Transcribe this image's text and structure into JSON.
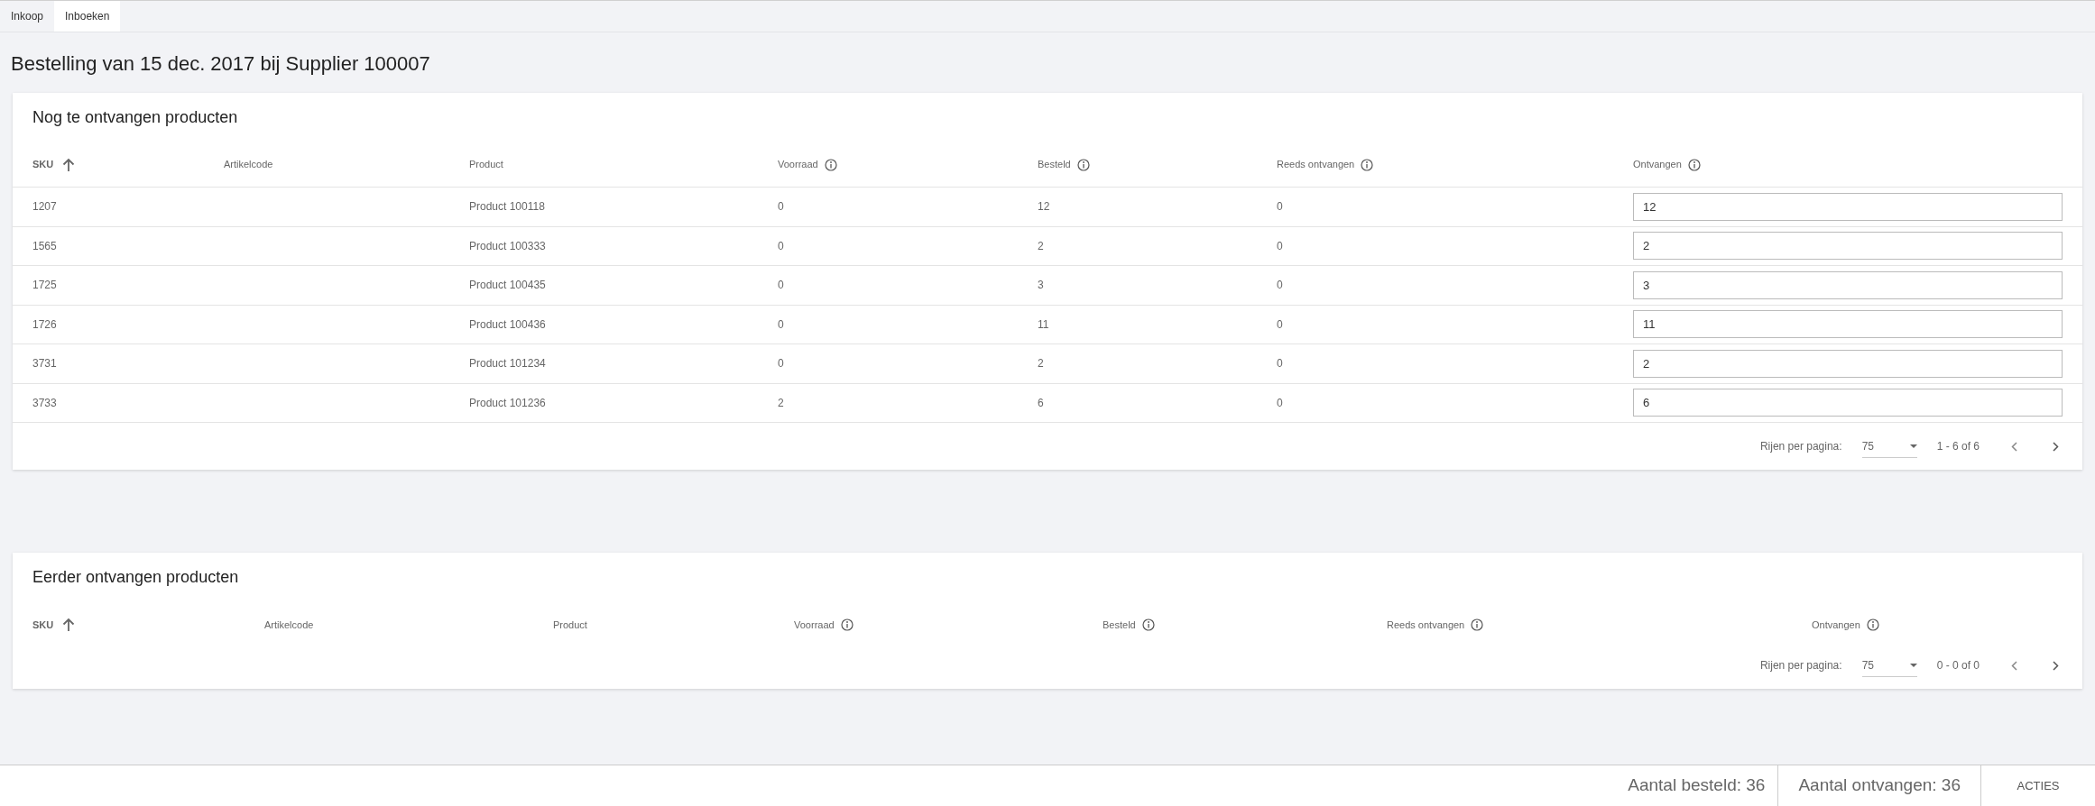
{
  "tabs": [
    {
      "label": "Inkoop",
      "selected": false
    },
    {
      "label": "Inboeken",
      "selected": true
    }
  ],
  "page_title": "Bestelling van 15 dec. 2017 bij Supplier 100007",
  "tables": [
    {
      "title": "Nog te ontvangen producten",
      "columns": [
        {
          "label": "SKU",
          "sorted": true,
          "info": false
        },
        {
          "label": "Artikelcode",
          "sorted": false,
          "info": false
        },
        {
          "label": "Product",
          "sorted": false,
          "info": false
        },
        {
          "label": "Voorraad",
          "sorted": false,
          "info": true
        },
        {
          "label": "Besteld",
          "sorted": false,
          "info": true
        },
        {
          "label": "Reeds ontvangen",
          "sorted": false,
          "info": true
        },
        {
          "label": "Ontvangen",
          "sorted": false,
          "info": true
        }
      ],
      "rows": [
        {
          "sku": "1207",
          "product": "Product 100118",
          "voorraad": "0",
          "besteld": "12",
          "reeds": "0",
          "ontvangen": "12"
        },
        {
          "sku": "1565",
          "product": "Product 100333",
          "voorraad": "0",
          "besteld": "2",
          "reeds": "0",
          "ontvangen": "2"
        },
        {
          "sku": "1725",
          "product": "Product 100435",
          "voorraad": "0",
          "besteld": "3",
          "reeds": "0",
          "ontvangen": "3"
        },
        {
          "sku": "1726",
          "product": "Product 100436",
          "voorraad": "0",
          "besteld": "11",
          "reeds": "0",
          "ontvangen": "11"
        },
        {
          "sku": "3731",
          "product": "Product 101234",
          "voorraad": "0",
          "besteld": "2",
          "reeds": "0",
          "ontvangen": "2"
        },
        {
          "sku": "3733",
          "product": "Product 101236",
          "voorraad": "2",
          "besteld": "6",
          "reeds": "0",
          "ontvangen": "6"
        }
      ],
      "pagination": {
        "label": "Rijen per pagina:",
        "per_page": "75",
        "range": "1 - 6 of 6"
      }
    },
    {
      "title": "Eerder ontvangen producten",
      "columns": [
        {
          "label": "SKU",
          "sorted": true,
          "info": false
        },
        {
          "label": "Artikelcode",
          "sorted": false,
          "info": false
        },
        {
          "label": "Product",
          "sorted": false,
          "info": false
        },
        {
          "label": "Voorraad",
          "sorted": false,
          "info": true
        },
        {
          "label": "Besteld",
          "sorted": false,
          "info": true
        },
        {
          "label": "Reeds ontvangen",
          "sorted": false,
          "info": true
        },
        {
          "label": "Ontvangen",
          "sorted": false,
          "info": true
        }
      ],
      "pagination": {
        "label": "Rijen per pagina:",
        "per_page": "75",
        "range": "0 - 0 of 0"
      }
    }
  ],
  "footer": {
    "ordered": "Aantal besteld: 36",
    "received": "Aantal ontvangen: 36",
    "action": "ACTIES"
  }
}
